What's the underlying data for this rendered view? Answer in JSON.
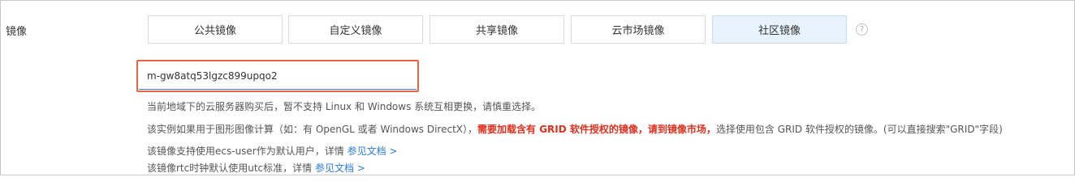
{
  "image_row": {
    "label": "镜像",
    "tabs": [
      {
        "label": "公共镜像",
        "active": false
      },
      {
        "label": "自定义镜像",
        "active": false
      },
      {
        "label": "共享镜像",
        "active": false
      },
      {
        "label": "云市场镜像",
        "active": false
      },
      {
        "label": "社区镜像",
        "active": true
      }
    ],
    "help_icon": "question-circle-icon",
    "help_glyph": "?"
  },
  "image_id_input": {
    "value": "m-gw8atq53lgzc899upqo2",
    "highlight_color": "#e4653f"
  },
  "hints": {
    "line1": "当前地域下的云服务器购买后，暂不支持 Linux 和 Windows 系统互相更换，请慎重选择。",
    "line2_pre": "该实例如果用于图形图像计算（如：有 OpenGL 或者 Windows DirectX），",
    "line2_red": "需要加载含有 GRID 软件授权的镜像，请到镜像市场，",
    "line2_post": "选择使用包含 GRID 软件授权的镜像。(可以直接搜索\"GRID\"字段)",
    "line3_text": "该镜像支持使用ecs-user作为默认用户，详情",
    "line3_link": "参见文档 >",
    "line4_text": "该镜像rtc时钟默认使用utc标准，详情",
    "line4_link": "参见文档 >"
  },
  "colors": {
    "active_tab_bg": "#e6f3fc",
    "warning_red": "#e0301e",
    "link_blue": "#2c7bd6"
  }
}
